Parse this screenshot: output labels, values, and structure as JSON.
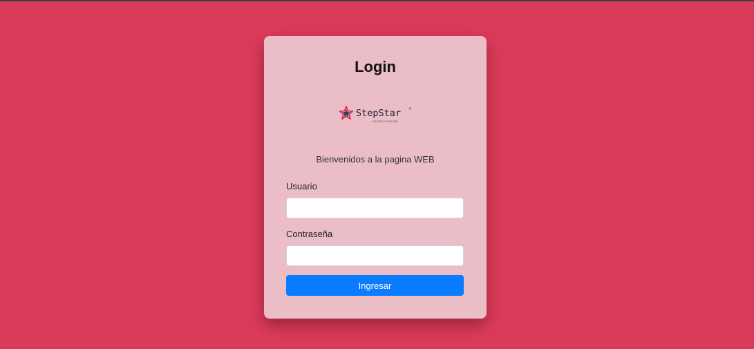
{
  "page": {
    "background_color": "#db3b5a",
    "card_color": "#ebbdc6",
    "accent_color": "#0a7cff"
  },
  "login": {
    "title": "Login",
    "logo": {
      "brand": "StepStar",
      "trademark": "®",
      "tagline": "you step is every step",
      "icon": "star-icon"
    },
    "welcome_text": "Bienvenidos a la pagina WEB",
    "username": {
      "label": "Usuario",
      "value": "",
      "placeholder": ""
    },
    "password": {
      "label": "Contraseña",
      "value": "",
      "placeholder": ""
    },
    "submit_label": "Ingresar"
  }
}
